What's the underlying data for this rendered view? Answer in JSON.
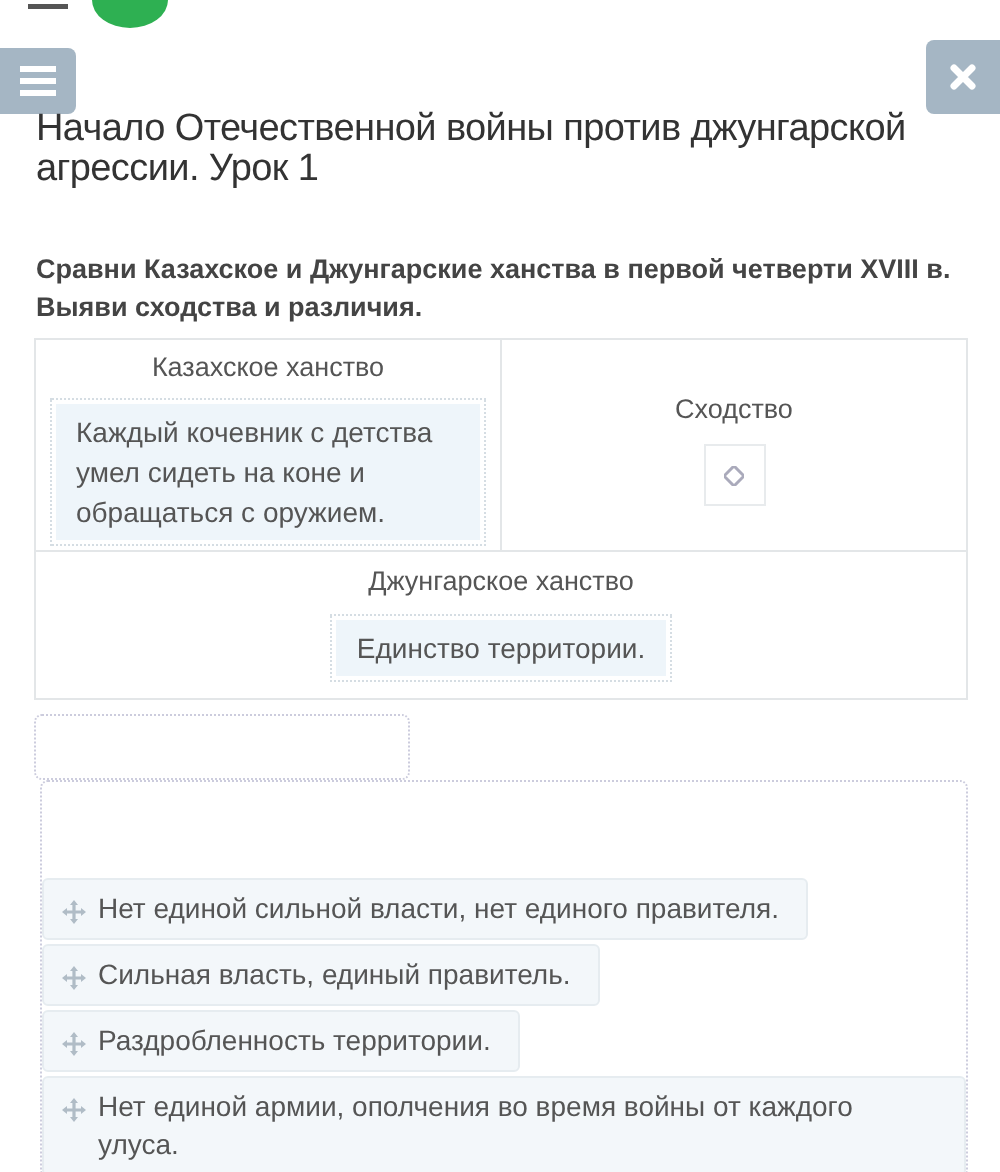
{
  "title": "Начало Отечественной войны против джунгарской агрессии. Урок 1",
  "question": "Сравни Казахское и Джунгарские ханства в первой четверти XVIII в. Выяви сходства и различия.",
  "table": {
    "rows": [
      {
        "cells": [
          {
            "header": "Казахское ханство",
            "items": [
              "Каждый кочевник с детства умел сидеть на коне и обращаться с оружием."
            ]
          },
          {
            "header": "Сходство"
          }
        ]
      },
      {
        "cells": [
          {
            "header": "Джунгарское ханство",
            "items": [
              "Единство территории."
            ]
          }
        ]
      }
    ]
  },
  "options": [
    {
      "text": "Нет единой сильной власти, нет единого правителя."
    },
    {
      "text": "Сильная власть, единый правитель."
    },
    {
      "text": "Раздробленность территории."
    },
    {
      "text": "Нет единой армии, ополчения во время войны от каждого улуса."
    }
  ]
}
